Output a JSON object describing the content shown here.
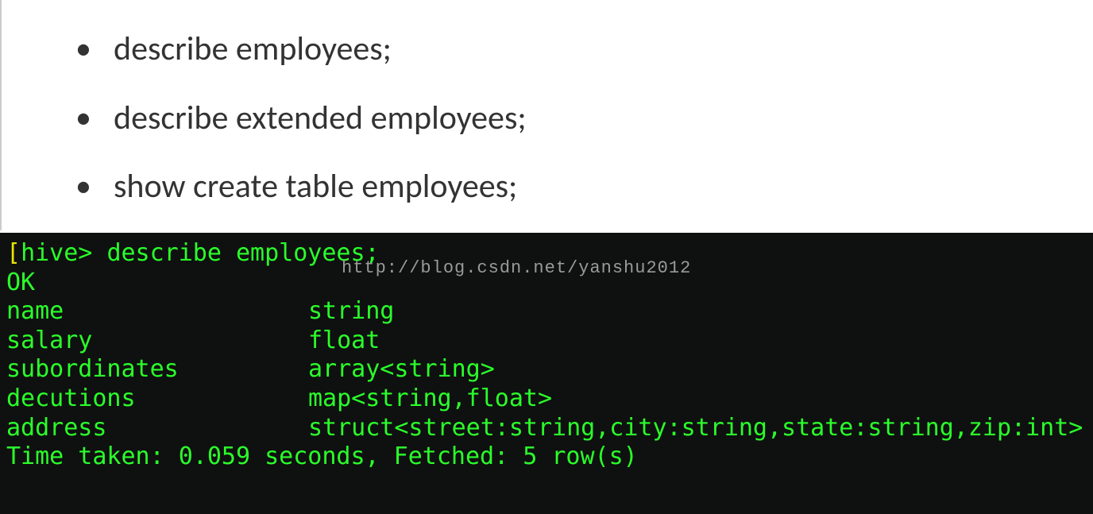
{
  "bullets": [
    "describe employees;",
    "describe extended employees;",
    "show create table employees;"
  ],
  "terminal": {
    "prompt_open": "[",
    "prompt": "hive>",
    "command": "describe employees;",
    "ok": "OK",
    "rows": [
      {
        "name": "name",
        "type": "string"
      },
      {
        "name": "salary",
        "type": "float"
      },
      {
        "name": "subordinates",
        "type": "array<string>"
      },
      {
        "name": "decutions",
        "type": "map<string,float>"
      },
      {
        "name": "address",
        "type": "struct<street:string,city:string,state:string,zip:int>"
      }
    ],
    "footer": "Time taken: 0.059 seconds, Fetched: 5 row(s)"
  },
  "watermark": "http://blog.csdn.net/yanshu2012"
}
